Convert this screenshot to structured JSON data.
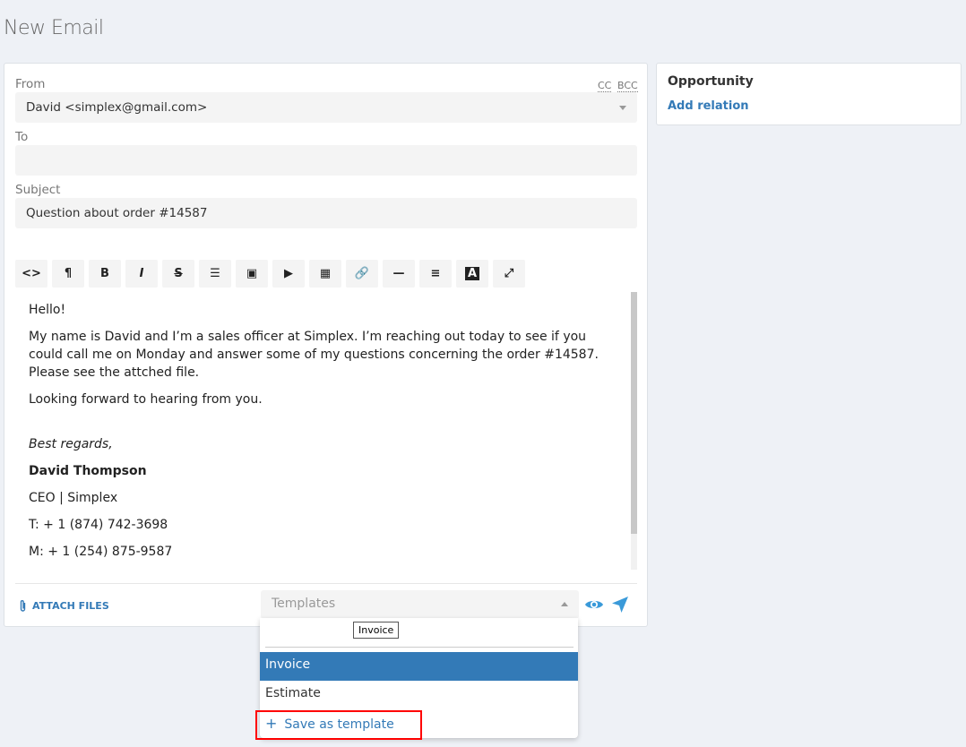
{
  "page": {
    "title": "New Email"
  },
  "form": {
    "from_label": "From",
    "from_value": "David <simplex@gmail.com>",
    "cc": "CC",
    "bcc": "BCC",
    "to_label": "To",
    "to_value": "",
    "subject_label": "Subject",
    "subject_value": "Question about order #14587"
  },
  "toolbar": [
    {
      "name": "code-view",
      "glyph": "<>"
    },
    {
      "name": "paragraph",
      "glyph": "¶"
    },
    {
      "name": "bold",
      "glyph": "B"
    },
    {
      "name": "italic",
      "glyph": "I"
    },
    {
      "name": "strikethrough",
      "glyph": "S"
    },
    {
      "name": "list",
      "glyph": "☰"
    },
    {
      "name": "image",
      "glyph": "▣"
    },
    {
      "name": "video",
      "glyph": "▶"
    },
    {
      "name": "table",
      "glyph": "▦"
    },
    {
      "name": "link",
      "glyph": "🔗"
    },
    {
      "name": "horizontal-rule",
      "glyph": "—"
    },
    {
      "name": "align",
      "glyph": "≡"
    },
    {
      "name": "font-color",
      "glyph": "A"
    },
    {
      "name": "fullscreen",
      "glyph": "⤢"
    }
  ],
  "body": {
    "greeting": "Hello!",
    "p1": "My name is David and I’m a sales officer at Simplex.  I’m reaching out today to see if you could call me on Monday and answer some of my questions concerning the order #14587. Please see the attched file.",
    "p2": "Looking forward to hearing from you.",
    "regards": "Best regards,",
    "name": "David Thompson",
    "role": "CEO | Simplex",
    "phone": "T: + 1 (874) 742-3698",
    "mobile": "M: + 1 (254) 875-9587"
  },
  "footer": {
    "attach": "ATTACH FILES",
    "templates_placeholder": "Templates"
  },
  "dropdown": {
    "search_value": "",
    "tooltip": "Invoice",
    "options": [
      "Invoice",
      "Estimate"
    ],
    "selected": "Invoice",
    "save": "Save as template"
  },
  "sidebar": {
    "title": "Opportunity",
    "add_relation": "Add relation"
  },
  "colors": {
    "accent": "#337ab7",
    "send": "#3a9ad9",
    "highlight": "#ff0000"
  }
}
